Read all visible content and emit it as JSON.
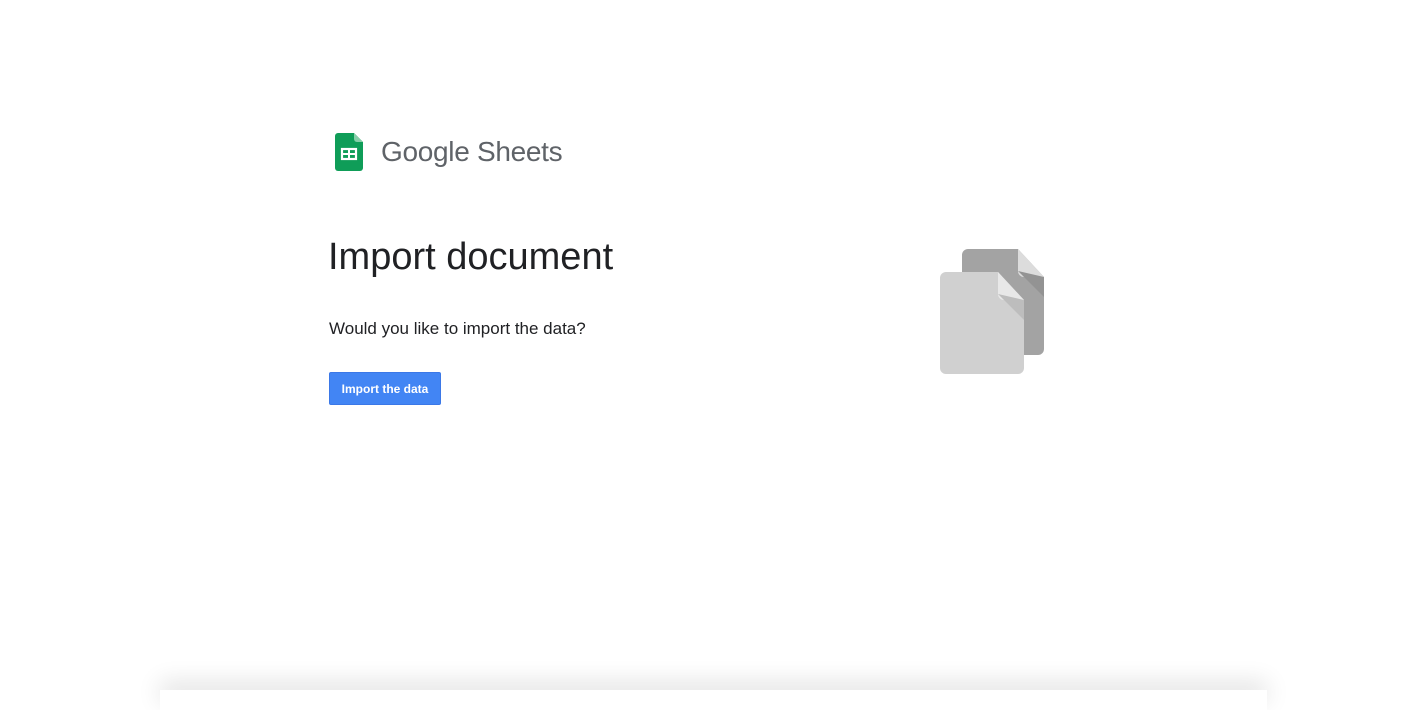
{
  "header": {
    "brand": "Google Sheets",
    "logo_icon": "google-sheets-icon"
  },
  "main": {
    "title": "Import document",
    "prompt": "Would you like to import the data?",
    "import_button_label": "Import the data",
    "illustration_icon": "documents-icon"
  },
  "colors": {
    "accent": "#4285f4",
    "sheets_green": "#0f9d58"
  }
}
